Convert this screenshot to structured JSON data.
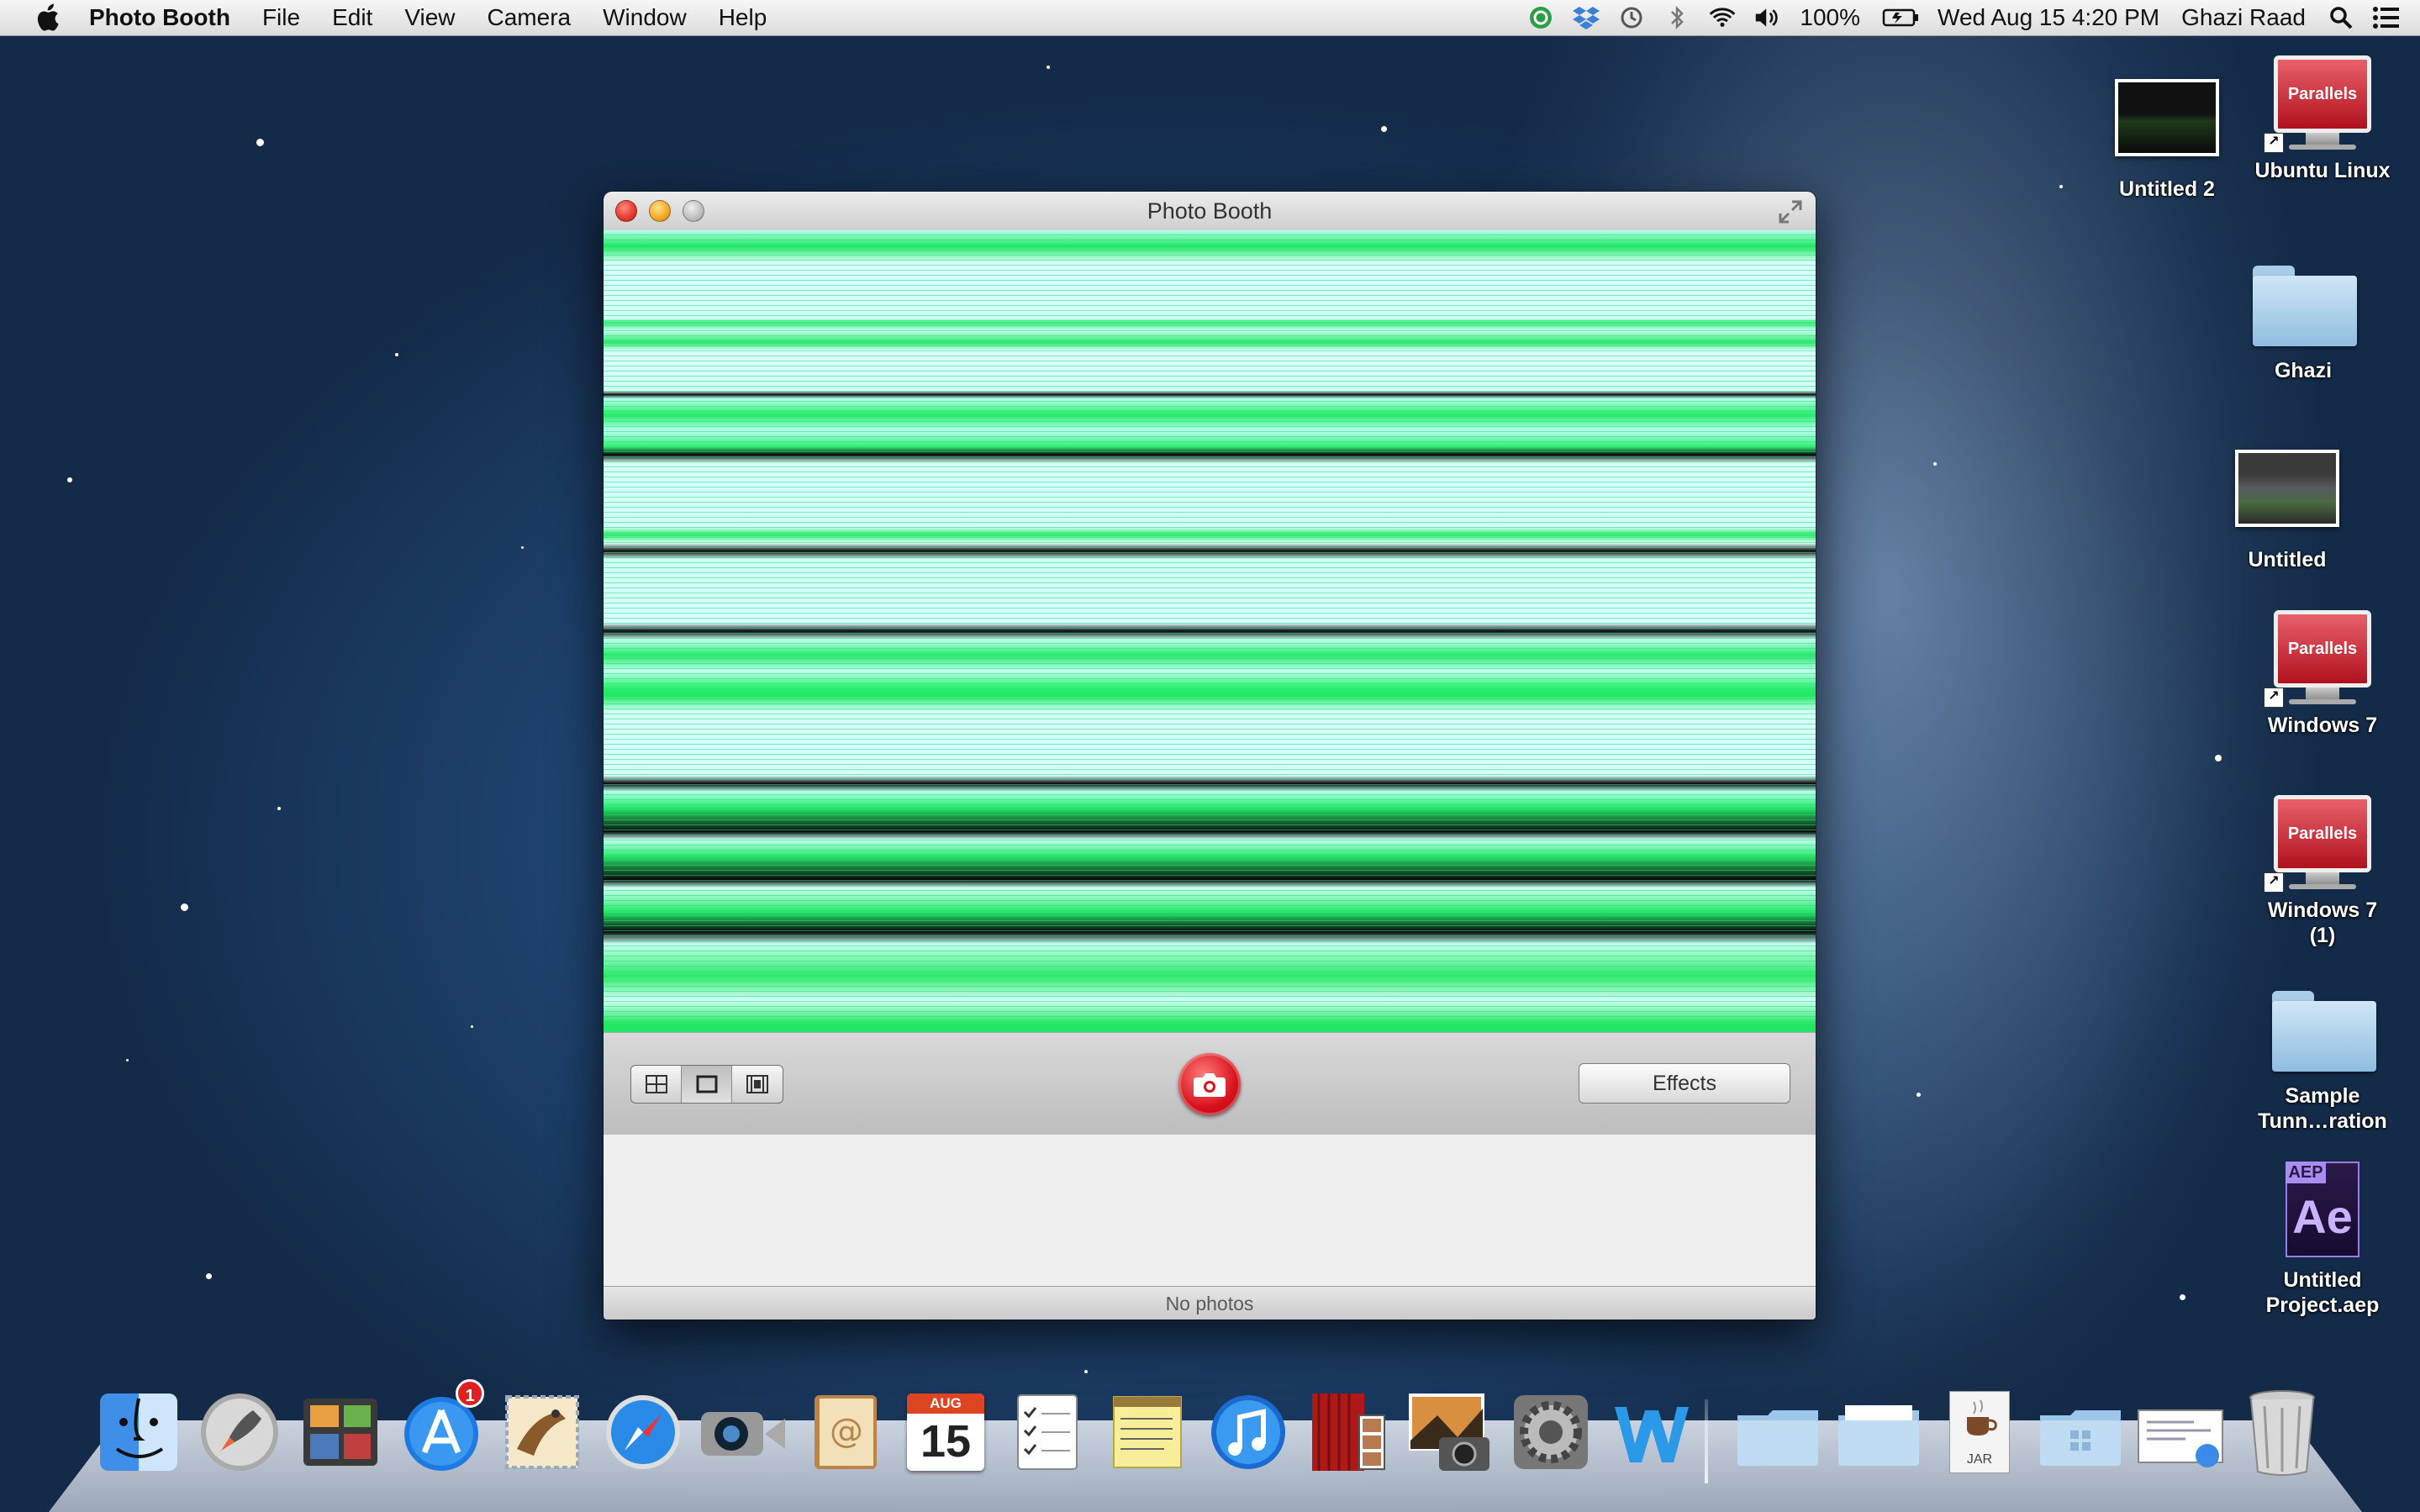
{
  "menubar": {
    "app_name": "Photo Booth",
    "menus": [
      "File",
      "Edit",
      "View",
      "Camera",
      "Window",
      "Help"
    ],
    "battery": "100%",
    "clock": "Wed Aug 15  4:20 PM",
    "user": "Ghazi Raad"
  },
  "desktop": {
    "icons": [
      {
        "label": "Untitled 2"
      },
      {
        "label": "Ubuntu Linux",
        "badge": "Parallels"
      },
      {
        "label": "Ghazi"
      },
      {
        "label": "Untitled"
      },
      {
        "label": "Windows 7",
        "badge": "Parallels"
      },
      {
        "label": "Windows 7\n(1)",
        "badge": "Parallels"
      },
      {
        "label": "Sample\nTunn…ration"
      },
      {
        "label": "Untitled\nProject.aep",
        "badge_top": "AEP",
        "badge_main": "Ae"
      }
    ]
  },
  "window": {
    "title": "Photo Booth",
    "effects_label": "Effects",
    "status": "No photos"
  },
  "dock": {
    "calendar_month": "AUG",
    "calendar_day": "15",
    "appstore_badge": "1",
    "jar_label": "JAR"
  }
}
